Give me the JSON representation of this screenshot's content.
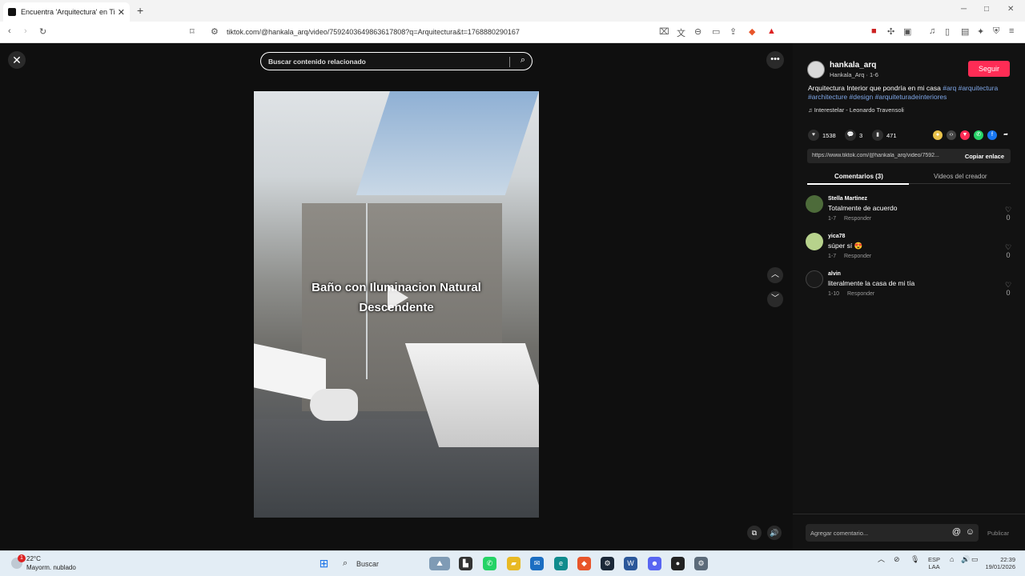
{
  "browser": {
    "tab_title": "Encuentra 'Arquitectura' en TikTok",
    "tab_close": "✕",
    "new_tab": "+",
    "url": "tiktok.com/@hankala_arq/video/7592403649863617808?q=Arquitectura&t=1768880290167"
  },
  "stage": {
    "close_glyph": "✕",
    "search_placeholder": "Buscar contenido relacionado",
    "more_glyph": "•••",
    "caption_line1": "Baño con Iluminacion Natural",
    "caption_line2": "Descendente",
    "prev_glyph": "︿",
    "next_glyph": "﹀"
  },
  "creator": {
    "username": "hankala_arq",
    "subtitle": "Hankala_Arq · 1-6",
    "follow_label": "Seguir",
    "description": "Arquitectura Interior que pondría en mi casa",
    "tags": "#arq #arquitectura #architecture #design #arquiteturadeinteriores",
    "music": "♫  Interestelar - Leonardo Travensoli"
  },
  "stats": {
    "likes": "1538",
    "comments": "3",
    "saves": "471"
  },
  "share": {
    "link": "https://www.tiktok.com/@hankala_arq/video/7592...",
    "copy_label": "Copiar enlace"
  },
  "tabs": {
    "comments": "Comentarios (3)",
    "creator_videos": "Videos del creador"
  },
  "comments": [
    {
      "name": "Stella Martinez",
      "text": "Totalmente de acuerdo",
      "date": "1-7",
      "reply": "Responder",
      "likes": "0"
    },
    {
      "name": "yica78",
      "text": "súper sí 😍",
      "date": "1-7",
      "reply": "Responder",
      "likes": "0"
    },
    {
      "name": "alvin",
      "text": "literalmente la casa de mi tía",
      "date": "1-10",
      "reply": "Responder",
      "likes": "0"
    }
  ],
  "composer": {
    "placeholder": "Agregar comentario...",
    "publish_label": "Publicar"
  },
  "taskbar": {
    "weather_temp": "22°C",
    "weather_desc": "Mayorm. nublado",
    "weather_badge": "1",
    "search_label": "Buscar",
    "lang_line1": "ESP",
    "lang_line2": "LAA",
    "time": "22:39",
    "date": "19/01/2026"
  },
  "colors": {
    "follow": "#fe2c55",
    "hashtag": "#7ea6e6",
    "stage_bg": "#0f0f0f"
  }
}
